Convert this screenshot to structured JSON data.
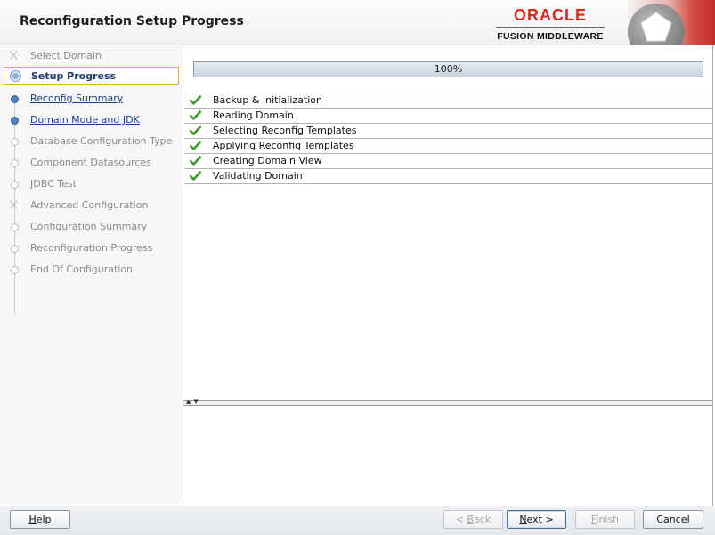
{
  "header": {
    "title": "Reconfiguration Setup Progress",
    "brand_name": "ORACLE",
    "brand_sub": "FUSION MIDDLEWARE",
    "brand_color": "#e2231a"
  },
  "steps": [
    {
      "label": "Select Domain",
      "state": "pending"
    },
    {
      "label": "Setup Progress",
      "state": "current"
    },
    {
      "label": "Reconfig Summary",
      "state": "done"
    },
    {
      "label": "Domain Mode and JDK",
      "state": "done"
    },
    {
      "label": "Database Configuration Type",
      "state": "pending"
    },
    {
      "label": "Component Datasources",
      "state": "pending"
    },
    {
      "label": "JDBC Test",
      "state": "pending"
    },
    {
      "label": "Advanced Configuration",
      "state": "pending"
    },
    {
      "label": "Configuration Summary",
      "state": "pending"
    },
    {
      "label": "Reconfiguration Progress",
      "state": "pending"
    },
    {
      "label": "End Of Configuration",
      "state": "pending"
    }
  ],
  "progress": {
    "text": "100%",
    "value": 100
  },
  "tasks": [
    {
      "name": "Backup & Initialization",
      "status": "complete",
      "icon": "check-icon"
    },
    {
      "name": "Reading Domain",
      "status": "complete",
      "icon": "check-icon"
    },
    {
      "name": "Selecting Reconfig Templates",
      "status": "complete",
      "icon": "check-icon"
    },
    {
      "name": "Applying Reconfig Templates",
      "status": "complete",
      "icon": "check-icon"
    },
    {
      "name": "Creating Domain View",
      "status": "complete",
      "icon": "check-icon"
    },
    {
      "name": "Validating Domain",
      "status": "complete",
      "icon": "check-icon"
    }
  ],
  "buttons": {
    "help": {
      "mnemonic": "H",
      "rest": "elp"
    },
    "back": {
      "pre": "< ",
      "mnemonic": "B",
      "rest": "ack",
      "enabled": false
    },
    "next": {
      "mnemonic": "N",
      "rest": "ext >",
      "enabled": true
    },
    "finish": {
      "mnemonic": "F",
      "rest": "inish",
      "enabled": false
    },
    "cancel": {
      "label": "Cancel"
    }
  },
  "colors": {
    "accent": "#1a3f8f",
    "check": "#3a9a2a",
    "current_border": "#e5a83a"
  }
}
